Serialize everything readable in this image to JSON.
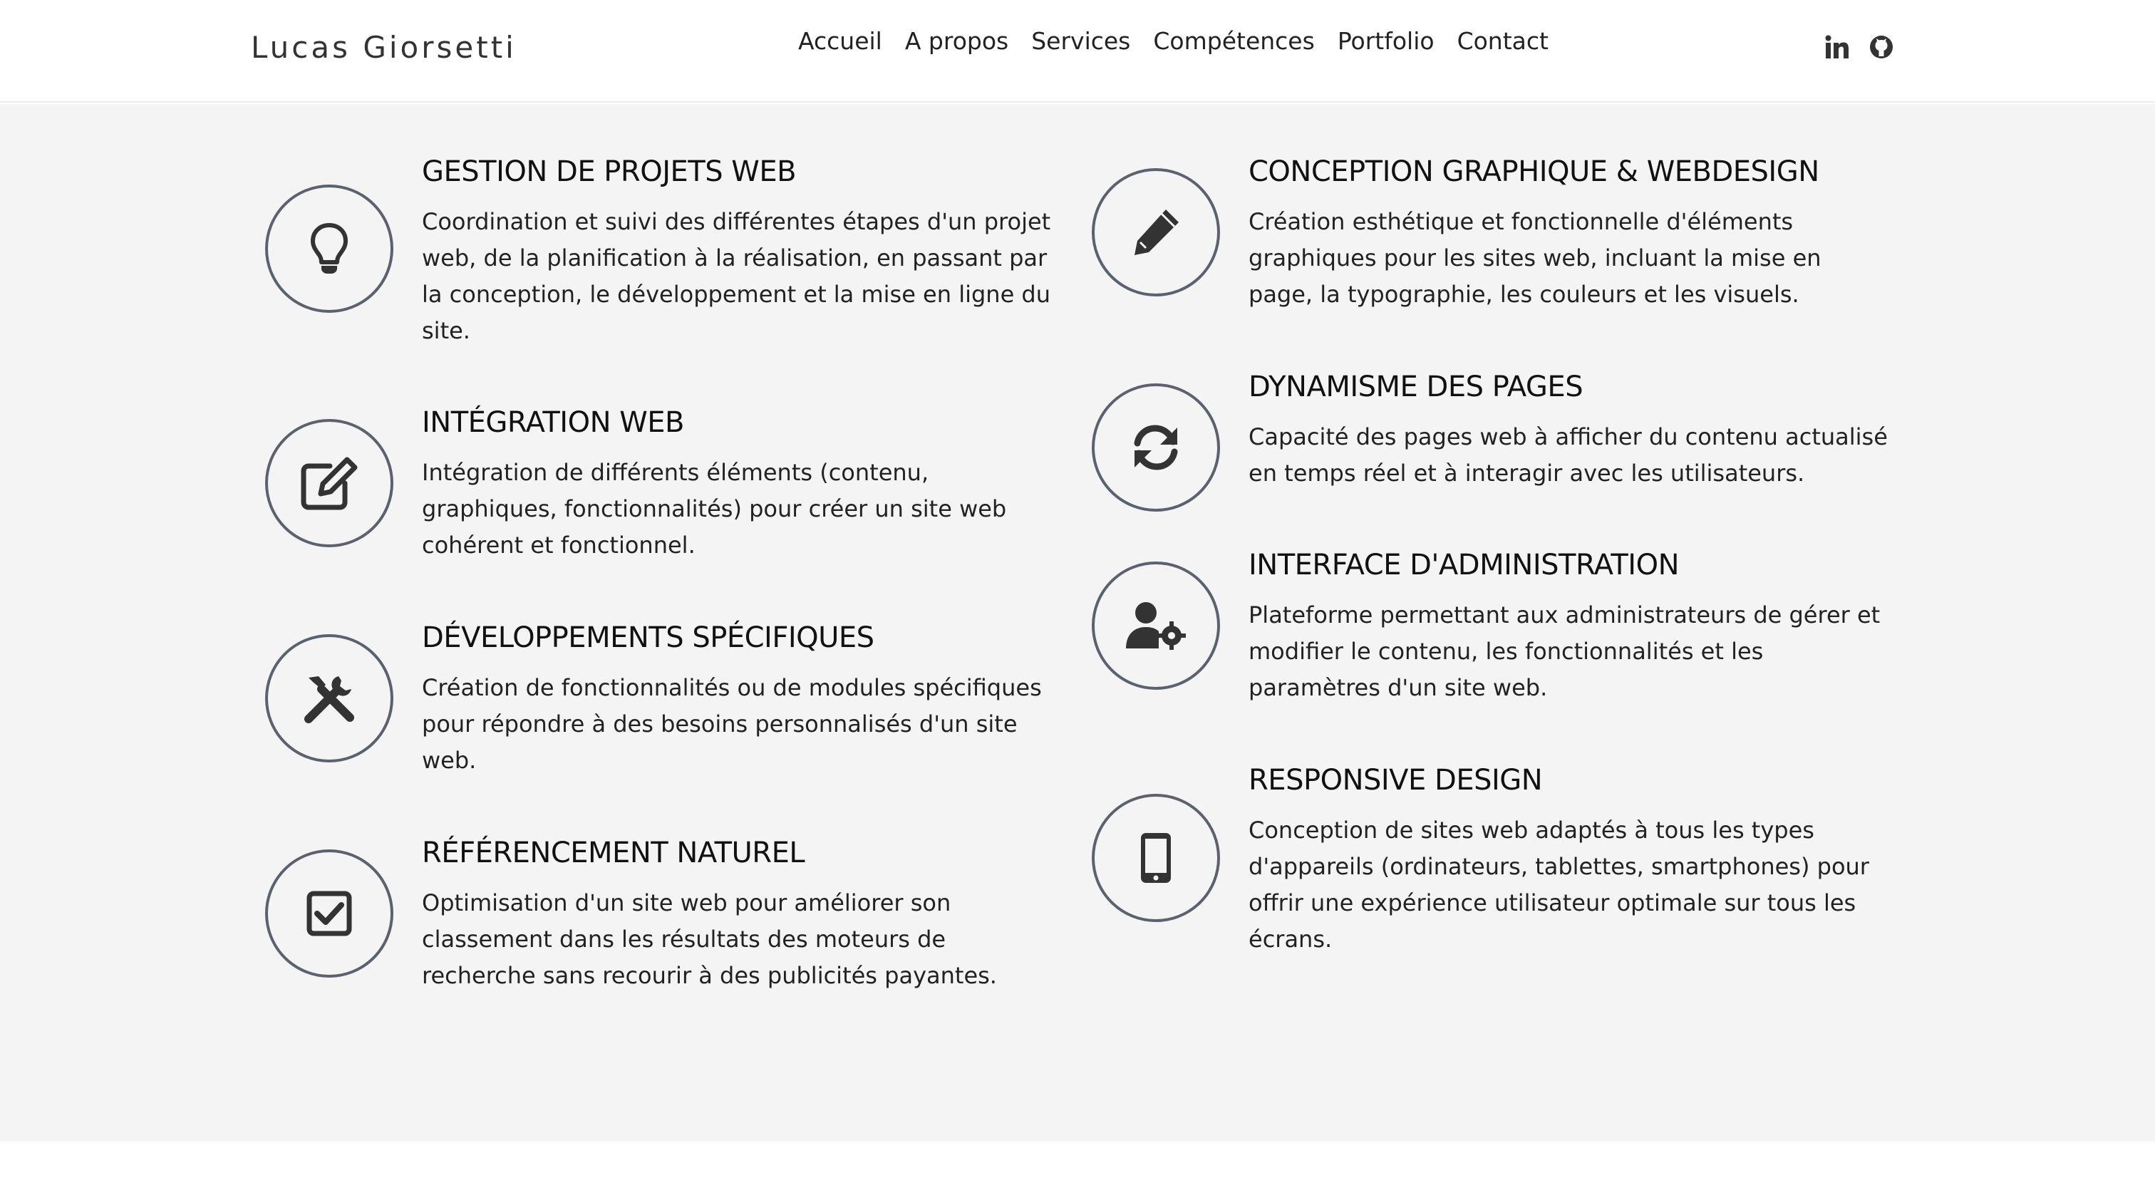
{
  "header": {
    "brand": "Lucas Giorsetti",
    "nav": [
      "Accueil",
      "A propos",
      "Services",
      "Compétences",
      "Portfolio",
      "Contact"
    ],
    "social_icons": [
      "linkedin-icon",
      "github-icon"
    ]
  },
  "services": {
    "left": [
      {
        "icon": "lightbulb-icon",
        "title": "GESTION DE PROJETS WEB",
        "description": "Coordination et suivi des différentes étapes d'un projet web, de la planification à la réalisation, en passant par la conception, le développement et la mise en ligne du site."
      },
      {
        "icon": "edit-icon",
        "title": "INTÉGRATION WEB",
        "description": "Intégration de différents éléments (contenu, graphiques, fonctionnalités) pour créer un site web cohérent et fonctionnel."
      },
      {
        "icon": "tools-icon",
        "title": "DÉVELOPPEMENTS SPÉCIFIQUES",
        "description": "Création de fonctionnalités ou de modules spécifiques pour répondre à des besoins personnalisés d'un site web."
      },
      {
        "icon": "checkbox-icon",
        "title": "RÉFÉRENCEMENT NATUREL",
        "description": "Optimisation d'un site web pour améliorer son classement dans les résultats des moteurs de recherche sans recourir à des publicités payantes."
      }
    ],
    "right": [
      {
        "icon": "pencil-icon",
        "title": "CONCEPTION GRAPHIQUE & WEBDESIGN",
        "description": "Création esthétique et fonctionnelle d'éléments graphiques pour les sites web, incluant la mise en page, la typographie, les couleurs et les visuels."
      },
      {
        "icon": "refresh-icon",
        "title": "DYNAMISME DES PAGES",
        "description": "Capacité des pages web à afficher du contenu actualisé en temps réel et à interagir avec les utilisateurs."
      },
      {
        "icon": "user-gear-icon",
        "title": "INTERFACE D'ADMINISTRATION",
        "description": "Plateforme permettant aux administrateurs de gérer et modifier le contenu, les fonctionnalités et les paramètres d'un site web."
      },
      {
        "icon": "mobile-icon",
        "title": "RESPONSIVE DESIGN",
        "description": "Conception de sites web adaptés à tous les types d'appareils (ordinateurs, tablettes, smartphones) pour offrir une expérience utilisateur optimale sur tous les écrans."
      }
    ]
  },
  "colors": {
    "background": "#f4f4f4",
    "circle_border": "#5a6270",
    "icon": "#333333",
    "text": "#222222"
  }
}
